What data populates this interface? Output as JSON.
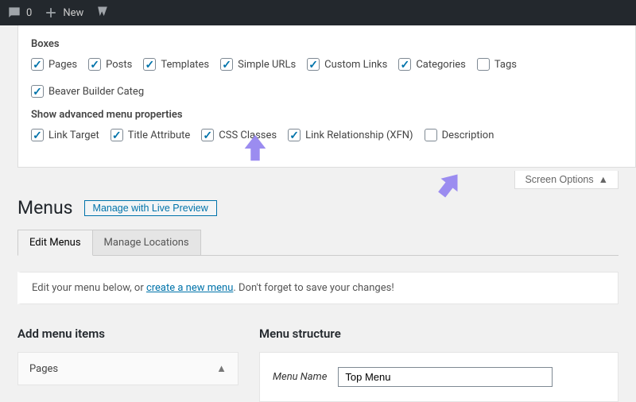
{
  "adminbar": {
    "comments": "0",
    "new_label": "New"
  },
  "screen_options": {
    "boxes_heading": "Boxes",
    "boxes": [
      {
        "label": "Pages",
        "checked": true
      },
      {
        "label": "Posts",
        "checked": true
      },
      {
        "label": "Templates",
        "checked": true
      },
      {
        "label": "Simple URLs",
        "checked": true
      },
      {
        "label": "Custom Links",
        "checked": true
      },
      {
        "label": "Categories",
        "checked": true
      },
      {
        "label": "Tags",
        "checked": false
      },
      {
        "label": "Beaver Builder Categ",
        "checked": true
      }
    ],
    "adv_heading": "Show advanced menu properties",
    "adv": [
      {
        "label": "Link Target",
        "checked": true
      },
      {
        "label": "Title Attribute",
        "checked": true
      },
      {
        "label": "CSS Classes",
        "checked": true
      },
      {
        "label": "Link Relationship (XFN)",
        "checked": true
      },
      {
        "label": "Description",
        "checked": false
      }
    ],
    "toggle_label": "Screen Options"
  },
  "page": {
    "title": "Menus",
    "live_preview": "Manage with Live Preview",
    "tabs": [
      {
        "label": "Edit Menus",
        "active": true
      },
      {
        "label": "Manage Locations",
        "active": false
      }
    ],
    "info_prefix": "Edit your menu below, or ",
    "info_link": "create a new menu",
    "info_suffix": ". Don't forget to save your changes!"
  },
  "left": {
    "heading": "Add menu items",
    "accordion": "Pages"
  },
  "right": {
    "heading": "Menu structure",
    "name_label": "Menu Name",
    "name_value": "Top Menu"
  }
}
